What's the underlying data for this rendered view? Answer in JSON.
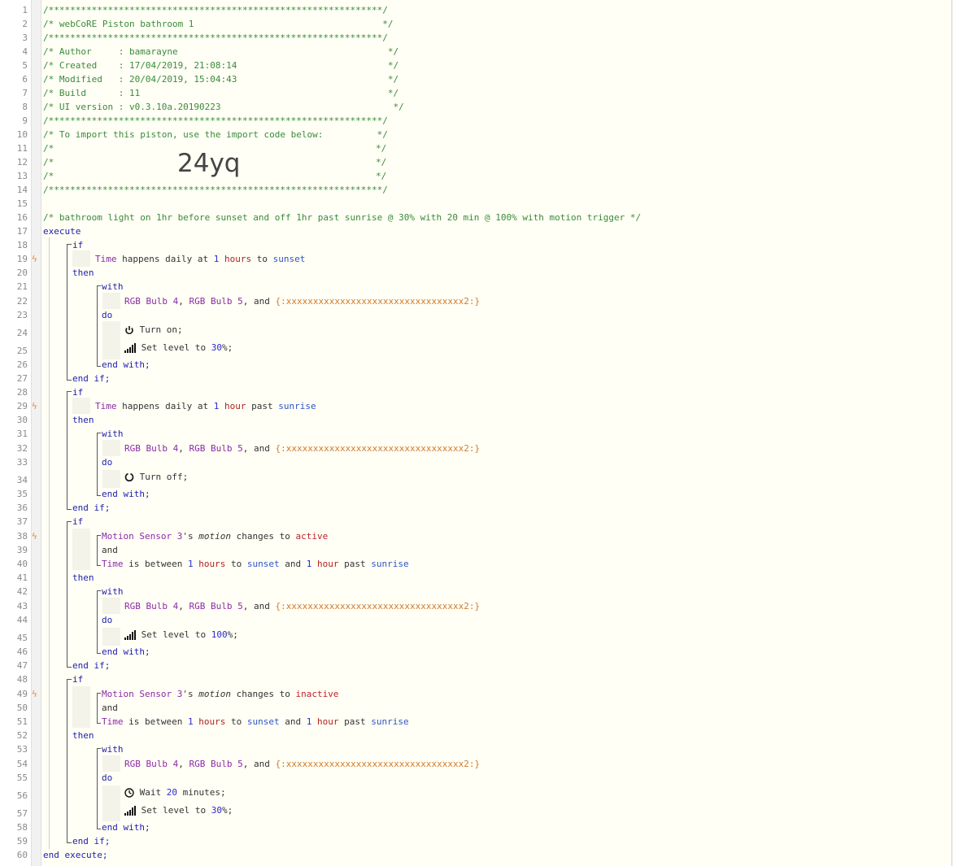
{
  "lines": [
    "1",
    "2",
    "3",
    "4",
    "5",
    "6",
    "7",
    "8",
    "9",
    "10",
    "11",
    "12",
    "13",
    "14",
    "15",
    "16",
    "17",
    "18",
    "19",
    "20",
    "21",
    "22",
    "23",
    "24",
    "25",
    "26",
    "27",
    "28",
    "29",
    "30",
    "31",
    "32",
    "33",
    "34",
    "35",
    "36",
    "37",
    "38",
    "39",
    "40",
    "41",
    "42",
    "43",
    "44",
    "45",
    "46",
    "47",
    "48",
    "49",
    "50",
    "51",
    "52",
    "53",
    "54",
    "55",
    "56",
    "57",
    "58",
    "59",
    "60"
  ],
  "header": {
    "stars": "/**************************************************************/",
    "title": "/* webCoRE Piston bathroom 1                                   */",
    "author": "/* Author     : bamarayne                                       */",
    "created": "/* Created    : 17/04/2019, 21:08:14                            */",
    "modified": "/* Modified   : 20/04/2019, 15:04:43                            */",
    "build": "/* Build      : 11                                              */",
    "ui": "/* UI version : v0.3.10a.20190223                                */",
    "import_hint": "/* To import this piston, use the import code below:          */",
    "blank_l": "/*",
    "blank_r": "*/",
    "import_code": "24yq"
  },
  "comment": "/* bathroom light on 1hr before sunset and off 1hr past sunrise @ 30% with 20 min @ 100% with motion trigger */",
  "kw": {
    "execute": "execute",
    "if": "if",
    "then": "then",
    "with": "with",
    "do": "do",
    "and": "and",
    "end_with": "end with;",
    "end_if": "end if;",
    "end_execute": "end execute;"
  },
  "devices": {
    "bulb4": "RGB Bulb 4",
    "bulb5": "RGB Bulb 5",
    "sensor": "Motion Sensor 3",
    "var": "{:xxxxxxxxxxxxxxxxxxxxxxxxxxxxxxxxx2:}"
  },
  "tokens": {
    "time": "Time",
    "happens_daily_at": "happens daily at",
    "one": "1",
    "twenty": "20",
    "hours": "hours",
    "hour": "hour",
    "to": "to",
    "past": "past",
    "sunset": "sunset",
    "sunrise": "sunrise",
    "comma": ",",
    "and_txt": ", and",
    "is_between": "is between",
    "apos_s": "'s",
    "motion": "motion",
    "changes_to": "changes to",
    "active": "active",
    "inactive": "inactive",
    "turn_on": "Turn on;",
    "turn_off": "Turn off;",
    "set_level_to": "Set level to",
    "pct30": "30",
    "pct100": "100",
    "pct_end": "%;",
    "wait": "Wait",
    "minutes": "minutes;"
  },
  "colors": {
    "comment": "#3a8a3a",
    "keyword": "#2020b0",
    "device": "#8a2aa8",
    "unit": "#b02020",
    "trigger": "#f0892e"
  },
  "icons": {
    "trigger": "lightning-bolt-icon",
    "power": "power-icon",
    "level": "signal-bars-icon",
    "clock": "clock-icon"
  }
}
